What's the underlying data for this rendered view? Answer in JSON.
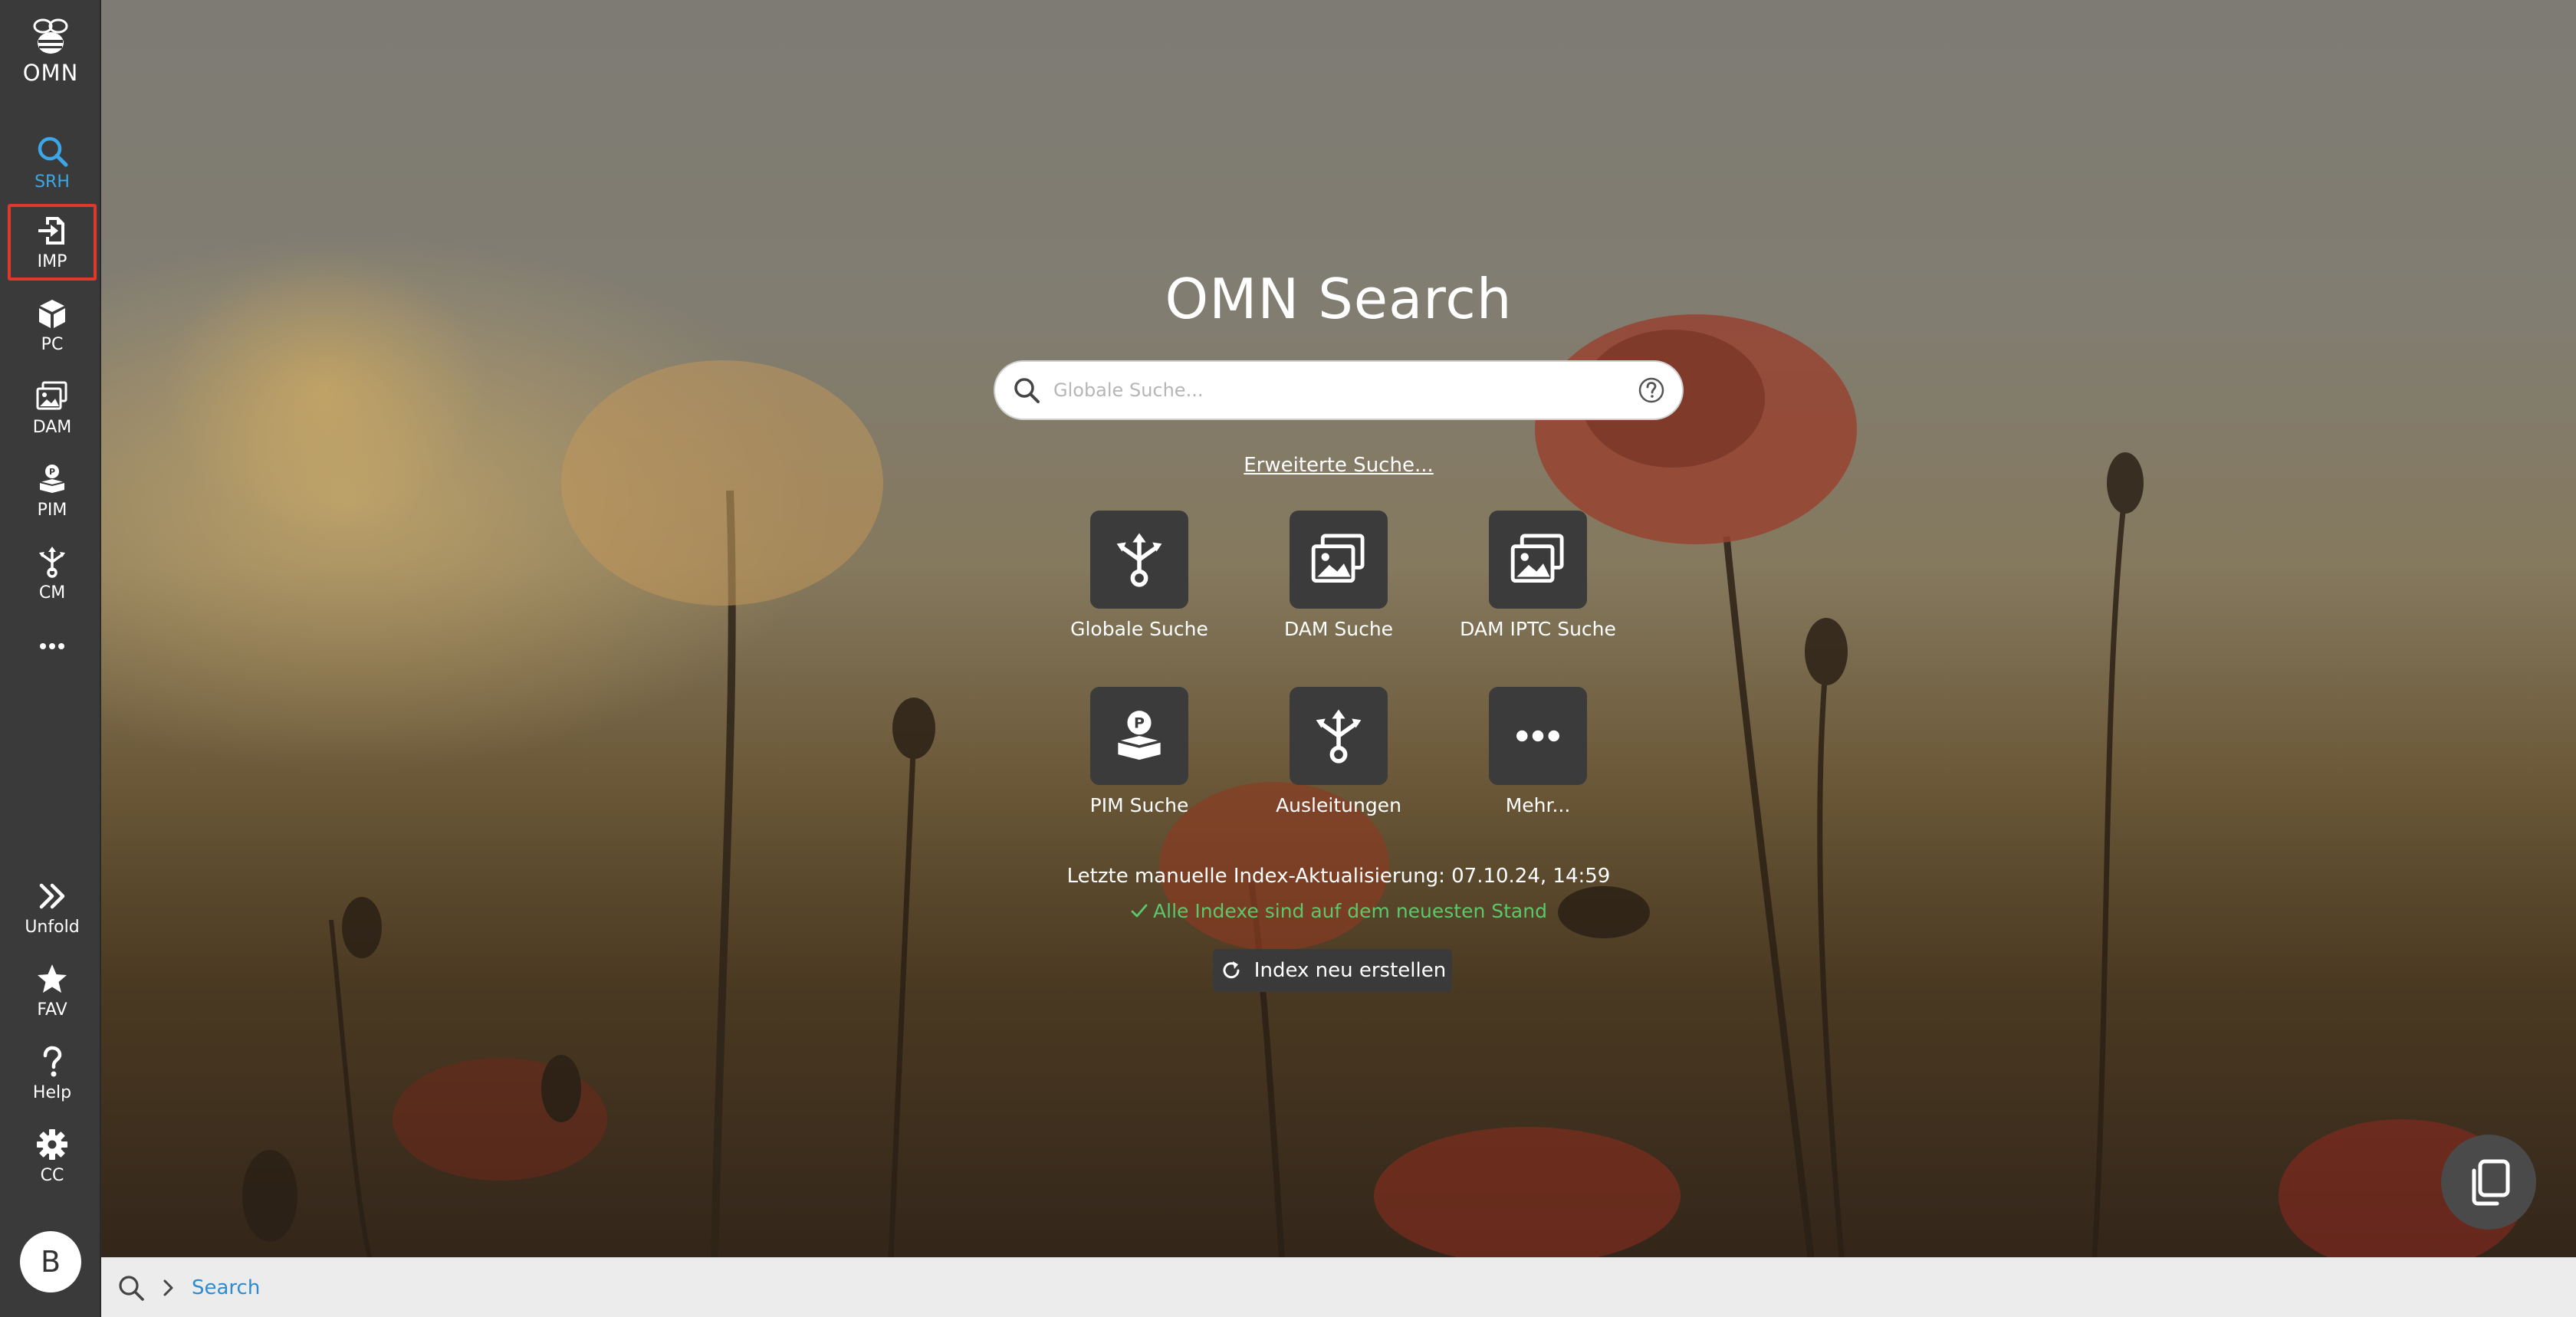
{
  "app": {
    "logo_text": "OMN",
    "logo_icon": "bee-icon"
  },
  "sidebar": {
    "items": [
      {
        "label": "SRH",
        "icon": "search-icon",
        "active": true
      },
      {
        "label": "IMP",
        "icon": "import-icon",
        "highlighted": true
      },
      {
        "label": "PC",
        "icon": "cube-icon"
      },
      {
        "label": "DAM",
        "icon": "images-icon"
      },
      {
        "label": "PIM",
        "icon": "pim-icon"
      },
      {
        "label": "CM",
        "icon": "channel-icon"
      },
      {
        "label": "",
        "icon": "more-icon"
      }
    ],
    "bottom_items": [
      {
        "label": "Unfold",
        "icon": "double-chevron-right-icon"
      },
      {
        "label": "FAV",
        "icon": "star-icon"
      },
      {
        "label": "Help",
        "icon": "question-icon"
      },
      {
        "label": "CC",
        "icon": "gear-icon"
      }
    ],
    "avatar_letter": "B"
  },
  "main": {
    "title": "OMN Search",
    "search": {
      "placeholder": "Globale Suche...",
      "value": ""
    },
    "advanced_link": "Erweiterte Suche...",
    "tiles": [
      {
        "label": "Globale Suche",
        "icon": "channel-icon"
      },
      {
        "label": "DAM Suche",
        "icon": "images-icon"
      },
      {
        "label": "DAM IPTC Suche",
        "icon": "images-icon"
      },
      {
        "label": "PIM Suche",
        "icon": "pim-icon"
      },
      {
        "label": "Ausleitungen",
        "icon": "channel-icon"
      },
      {
        "label": "Mehr...",
        "icon": "more-icon"
      }
    ],
    "last_update": "Letzte manuelle Index-Aktualisierung: 07.10.24, 14:59",
    "status_text": "Alle Indexe sind auf dem neuesten Stand",
    "rebuild_button": "Index neu erstellen"
  },
  "breadcrumb": {
    "items": [
      "Search"
    ]
  },
  "colors": {
    "sidebar_bg": "#3a3a3a",
    "accent": "#3ca7e6",
    "highlight_border": "#e0392b",
    "status_ok": "#5cc86a",
    "link": "#2d8ccf"
  }
}
